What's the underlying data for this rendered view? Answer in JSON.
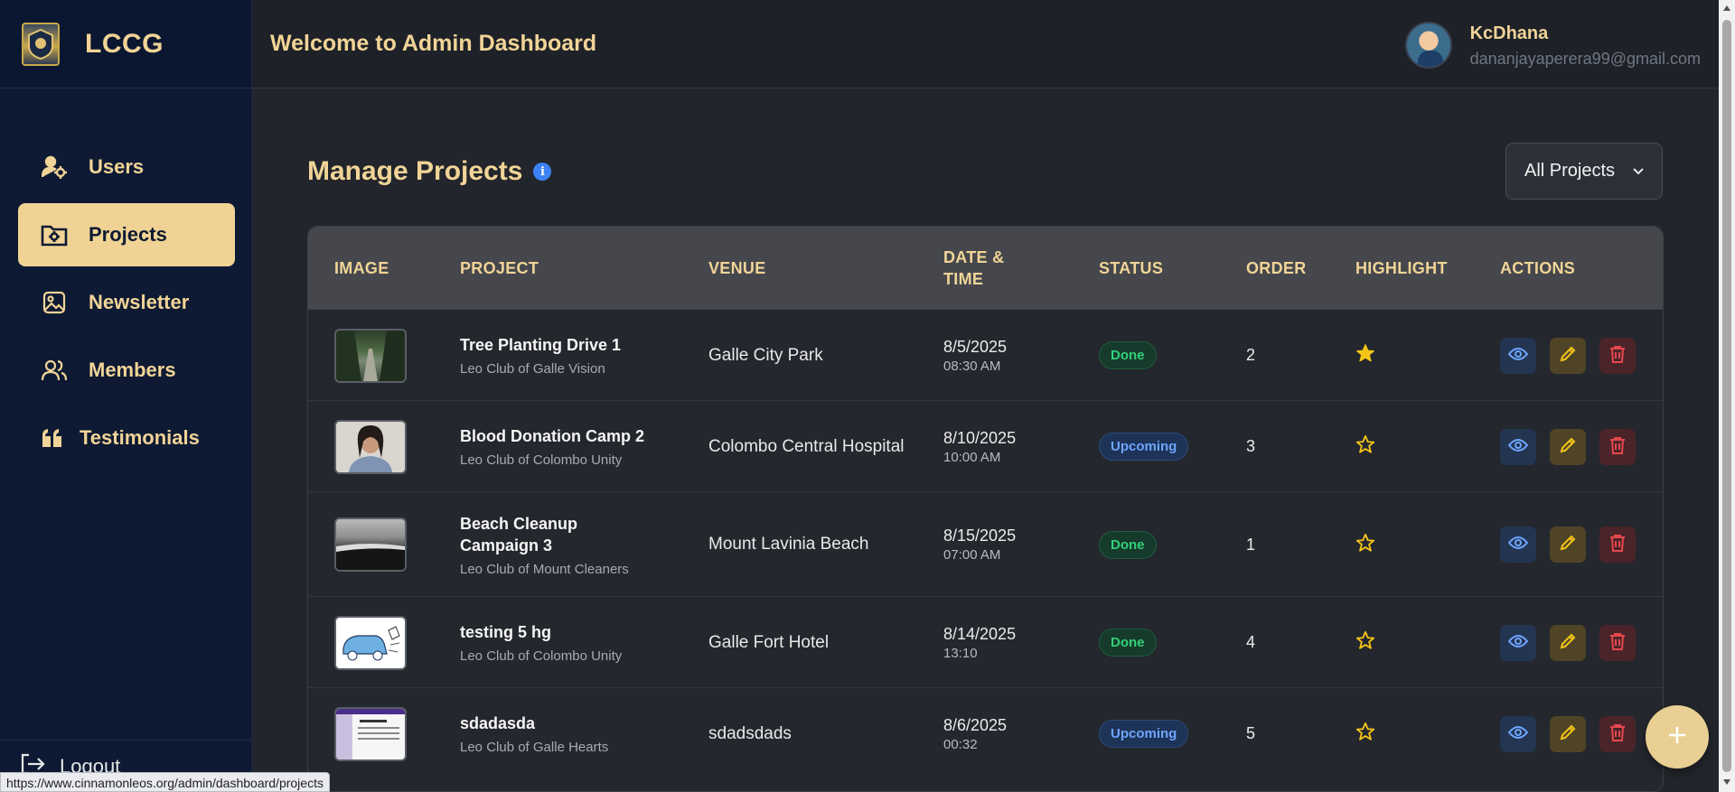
{
  "brand": {
    "name": "LCCG"
  },
  "header": {
    "welcome": "Welcome to Admin Dashboard",
    "user_name": "KcDhana",
    "user_email": "dananjayaperera99@gmail.com"
  },
  "sidebar": {
    "items": [
      {
        "label": "Users",
        "icon": "users-gear-icon",
        "active": false
      },
      {
        "label": "Projects",
        "icon": "folder-gear-icon",
        "active": true
      },
      {
        "label": "Newsletter",
        "icon": "image-icon",
        "active": false
      },
      {
        "label": "Members",
        "icon": "people-icon",
        "active": false
      },
      {
        "label": "Testimonials",
        "icon": "quote-icon",
        "active": false
      }
    ],
    "logout": "Logout"
  },
  "main": {
    "title": "Manage Projects",
    "filter": "All Projects",
    "columns": [
      "IMAGE",
      "PROJECT",
      "VENUE",
      "DATE & TIME",
      "STATUS",
      "ORDER",
      "HIGHLIGHT",
      "ACTIONS"
    ],
    "rows": [
      {
        "title": "Tree Planting Drive 1",
        "club": "Leo Club of Galle Vision",
        "venue": "Galle City Park",
        "date": "8/5/2025",
        "time": "08:30 AM",
        "status": "Done",
        "order": "2",
        "highlight": true,
        "image": "forest-walkway"
      },
      {
        "title": "Blood Donation Camp 2",
        "club": "Leo Club of Colombo Unity",
        "venue": "Colombo Central Hospital",
        "date": "8/10/2025",
        "time": "10:00 AM",
        "status": "Upcoming",
        "order": "3",
        "highlight": false,
        "image": "portrait"
      },
      {
        "title": "Beach Cleanup Campaign 3",
        "club": "Leo Club of Mount Cleaners",
        "venue": "Mount Lavinia Beach",
        "date": "8/15/2025",
        "time": "07:00 AM",
        "status": "Done",
        "order": "1",
        "highlight": false,
        "image": "rocky-beach"
      },
      {
        "title": "testing 5 hg",
        "club": "Leo Club of Colombo Unity",
        "venue": "Galle Fort Hotel",
        "date": "8/14/2025",
        "time": "13:10",
        "status": "Done",
        "order": "4",
        "highlight": false,
        "image": "car-sketch"
      },
      {
        "title": "sdadasda",
        "club": "Leo Club of Galle Hearts",
        "venue": "sdadsdads",
        "date": "8/6/2025",
        "time": "00:32",
        "status": "Upcoming",
        "order": "5",
        "highlight": false,
        "image": "webpage-screenshot"
      }
    ]
  },
  "statusbar": {
    "url": "https://www.cinnamonleos.org/admin/dashboard/projects"
  },
  "colors": {
    "accent": "#f1d497",
    "sidebar": "#0e1a33",
    "done": "#32d07a",
    "upcoming": "#6ea5ff",
    "star": "#f5c518"
  }
}
